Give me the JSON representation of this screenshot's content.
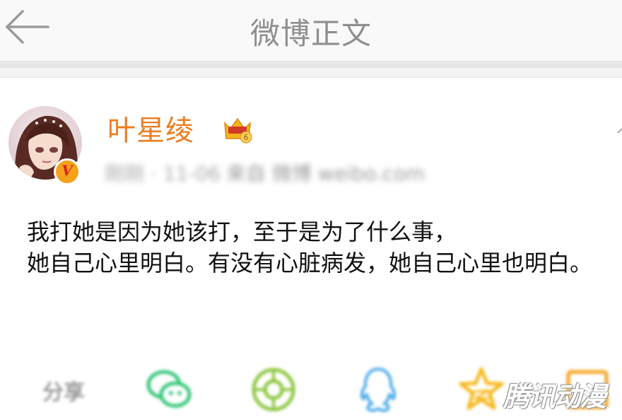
{
  "header": {
    "title": "微博正文",
    "back_icon": "arrow-left-icon"
  },
  "post": {
    "author": "叶星绫",
    "level_badge": "6",
    "verified_mark": "V",
    "meta_time": "刚刚 · 11-06",
    "meta_source": "来自 微博 weibo.com",
    "text_line1": "我打她是因为她该打，至于是为了什么事，",
    "text_line2": "她自己心里明白。有没有心脏病发，她自己心里也明白。"
  },
  "share": {
    "label": "分享",
    "targets": [
      "wechat-icon",
      "moments-icon",
      "qq-icon",
      "qzone-icon",
      "favorite-icon"
    ]
  },
  "watermark": "腾讯动漫",
  "colors": {
    "username": "#ec7d1f",
    "title": "#8f8f8f",
    "wechat": "#35c57a",
    "moments": "#8cc63e",
    "qq": "#4aa8e8",
    "qzone": "#f5b81e",
    "badge": "#f5a21b"
  }
}
